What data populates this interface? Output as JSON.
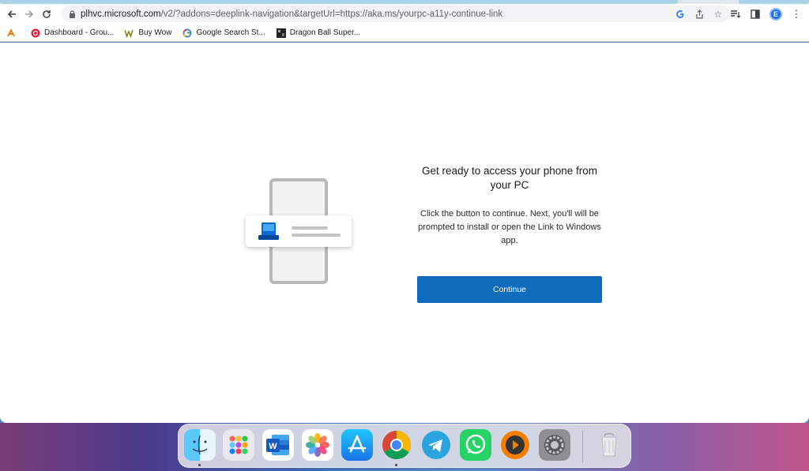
{
  "browser": {
    "url_domain": "plhvc.microsoft.com",
    "url_path": "/v2/?addons=deeplink-navigation&targetUrl=https://aka.ms/yourpc-a11y-continue-link",
    "profile_initial": "E"
  },
  "bookmarks": [
    {
      "label": "",
      "icon": "app-icon"
    },
    {
      "label": "Dashboard - Grou...",
      "icon": "dashboard-icon"
    },
    {
      "label": "Buy Wow",
      "icon": "wow-icon"
    },
    {
      "label": "Google Search St...",
      "icon": "google-icon"
    },
    {
      "label": "Dragon Ball Super...",
      "icon": "dragonball-icon"
    }
  ],
  "page": {
    "headline": "Get ready to access your phone from your PC",
    "body": "Click the button to continue. Next, you'll will be prompted to install or open the Link to Windows app.",
    "continue_label": "Continue"
  },
  "dock": {
    "apps": [
      "Finder",
      "Launchpad",
      "Microsoft Word",
      "Photos",
      "App Store",
      "Google Chrome",
      "Telegram",
      "WhatsApp",
      "Infuse",
      "System Preferences",
      "Trash"
    ]
  },
  "colors": {
    "accent": "#0f6cbd",
    "text": "#1b1b1b"
  }
}
